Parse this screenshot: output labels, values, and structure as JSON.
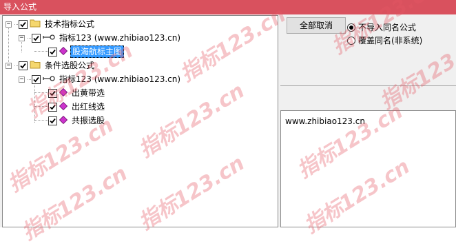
{
  "window": {
    "title": "导入公式"
  },
  "tree": {
    "nodes": [
      {
        "label": "技术指标公式",
        "icon": "folder-icon"
      },
      {
        "label": "指标123  (www.zhibiao123.cn)",
        "icon": "key-icon"
      },
      {
        "label": "股海航标主图",
        "icon": "formula-diamond-icon",
        "selected": true
      },
      {
        "label": "条件选股公式",
        "icon": "folder-icon"
      },
      {
        "label": "指标123  (www.zhibiao123.cn)",
        "icon": "key-icon"
      },
      {
        "label": "出黄带选",
        "icon": "formula-diamond-icon"
      },
      {
        "label": "出红线选",
        "icon": "formula-diamond-icon"
      },
      {
        "label": "共振选股",
        "icon": "formula-diamond-icon"
      }
    ]
  },
  "actions": {
    "cancel_all_label": "全部取消",
    "radio_options": [
      {
        "label": "不导入同名公式",
        "selected": true
      },
      {
        "label": "覆盖同名(非系统)",
        "selected": false
      }
    ]
  },
  "info": {
    "url": "www.zhibiao123.cn"
  },
  "watermark": {
    "text": "指标123.cn"
  },
  "colors": {
    "titlebar": "#d9515e",
    "selection": "#3399ff",
    "diamond": "#cc33cc"
  }
}
